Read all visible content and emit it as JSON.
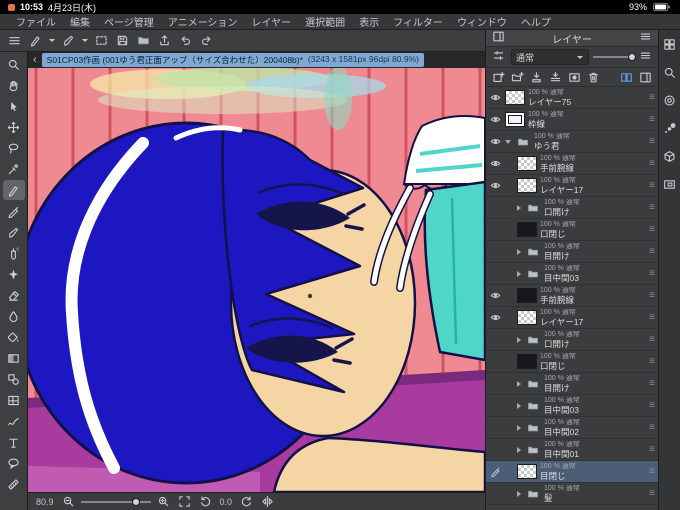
{
  "status_bar": {
    "time": "10:53",
    "date": "4月23日(木)",
    "battery_percent": "93%"
  },
  "menu_bar": {
    "items": [
      "ファイル",
      "編集",
      "ページ管理",
      "アニメーション",
      "レイヤー",
      "選択範囲",
      "表示",
      "フィルター",
      "ウィンドウ",
      "ヘルプ"
    ]
  },
  "command_bar": {
    "icons": [
      "menu",
      "pen",
      "brush",
      "marquee",
      "save",
      "folder",
      "export",
      "undo",
      "redo"
    ]
  },
  "document_tab": {
    "back_chevron": "‹",
    "name": "S01CP03作画 (001ゆう君正面アップ（サイズ合わせた）200408b)*",
    "info": "(3243 x 1581px 96dpi 80.9%)"
  },
  "tool_palette": {
    "selected": "pen",
    "tools": [
      "zoom",
      "hand",
      "object",
      "move-layer",
      "lasso",
      "eyedropper",
      "pen",
      "pencil",
      "brush",
      "airbrush",
      "decoration",
      "eraser",
      "blend",
      "fill",
      "gradient",
      "figure",
      "frame",
      "correct-line",
      "text",
      "balloon",
      "ruler"
    ]
  },
  "layers_panel": {
    "title": "レイヤー",
    "blend_mode": "通常",
    "tool_icons": [
      "new-layer",
      "new-folder",
      "transfer-down",
      "merge-down",
      "mask",
      "delete"
    ],
    "right_icons": [
      "two-pane",
      "dock"
    ],
    "rows": [
      {
        "meta": "100 % 通常",
        "name": "レイヤー75",
        "kind": "layer",
        "thumb": "checker",
        "eye": true
      },
      {
        "meta": "100 % 通常",
        "name": "枠線",
        "kind": "layer",
        "thumb": "frame",
        "eye": true
      },
      {
        "meta": "100 % 通常",
        "name": "ゆう君",
        "kind": "folder",
        "expanded": true,
        "eye": true
      },
      {
        "meta": "100 % 通常",
        "name": "手前腕線",
        "kind": "layer",
        "thumb": "checker",
        "eye": true,
        "indent": 1
      },
      {
        "meta": "100 % 通常",
        "name": "レイヤー17",
        "kind": "layer",
        "thumb": "checker",
        "eye": true,
        "indent": 1
      },
      {
        "meta": "100 % 通常",
        "name": "口開け",
        "kind": "folder",
        "indent": 1
      },
      {
        "meta": "100 % 通常",
        "name": "口閉じ",
        "kind": "layer",
        "thumb": "dark",
        "indent": 1
      },
      {
        "meta": "100 % 通常",
        "name": "目開け",
        "kind": "folder",
        "indent": 1
      },
      {
        "meta": "100 % 通常",
        "name": "目中間03",
        "kind": "folder",
        "indent": 1
      },
      {
        "meta": "100 % 通常",
        "name": "手前腕線",
        "kind": "layer",
        "thumb": "dark",
        "eye": true,
        "indent": 1
      },
      {
        "meta": "100 % 通常",
        "name": "レイヤー17",
        "kind": "layer",
        "thumb": "checker",
        "eye": true,
        "indent": 1
      },
      {
        "meta": "100 % 通常",
        "name": "口開け",
        "kind": "folder",
        "indent": 1
      },
      {
        "meta": "100 % 通常",
        "name": "口閉じ",
        "kind": "layer",
        "thumb": "dark",
        "indent": 1
      },
      {
        "meta": "100 % 通常",
        "name": "目開け",
        "kind": "folder",
        "indent": 1
      },
      {
        "meta": "100 % 通常",
        "name": "目中間03",
        "kind": "folder",
        "indent": 1
      },
      {
        "meta": "100 % 通常",
        "name": "目中間02",
        "kind": "folder",
        "indent": 1
      },
      {
        "meta": "100 % 通常",
        "name": "目中間01",
        "kind": "folder",
        "indent": 1
      },
      {
        "meta": "100 % 通常",
        "name": "目閉じ",
        "kind": "layer",
        "thumb": "checker",
        "selected": true,
        "pencil": true,
        "indent": 1
      },
      {
        "meta": "100 % 通常",
        "name": "髪",
        "kind": "folder",
        "indent": 1
      }
    ]
  },
  "right_dock": {
    "icons": [
      "quick-access",
      "search",
      "color-wheel",
      "brush-size",
      "material-cube",
      "navigator"
    ]
  },
  "bottom_bar": {
    "zoom_value": "80.9",
    "rotation_value": "0.0",
    "icons": [
      "zoom-out",
      "zoom-slider",
      "zoom-in",
      "fit-screen",
      "rotate-ccw",
      "rotate-cw",
      "flip-h"
    ]
  },
  "artwork": {
    "colors": {
      "wall": "#f08a92",
      "wall_stripe": "#d25260",
      "haze_yellow": "#f5eaa8",
      "haze_green": "#bfe6a8",
      "haze_blue": "#a8d8ec",
      "bed": "#a93a9e",
      "bed_shadow": "#7c2a80",
      "bed_light": "#d67ec4",
      "hair": "#1c17c0",
      "line": "#131048",
      "skin": "#f6d5a4",
      "shirt": "#4fd6c9",
      "white": "#ffffff",
      "eye": "#15154b"
    }
  }
}
